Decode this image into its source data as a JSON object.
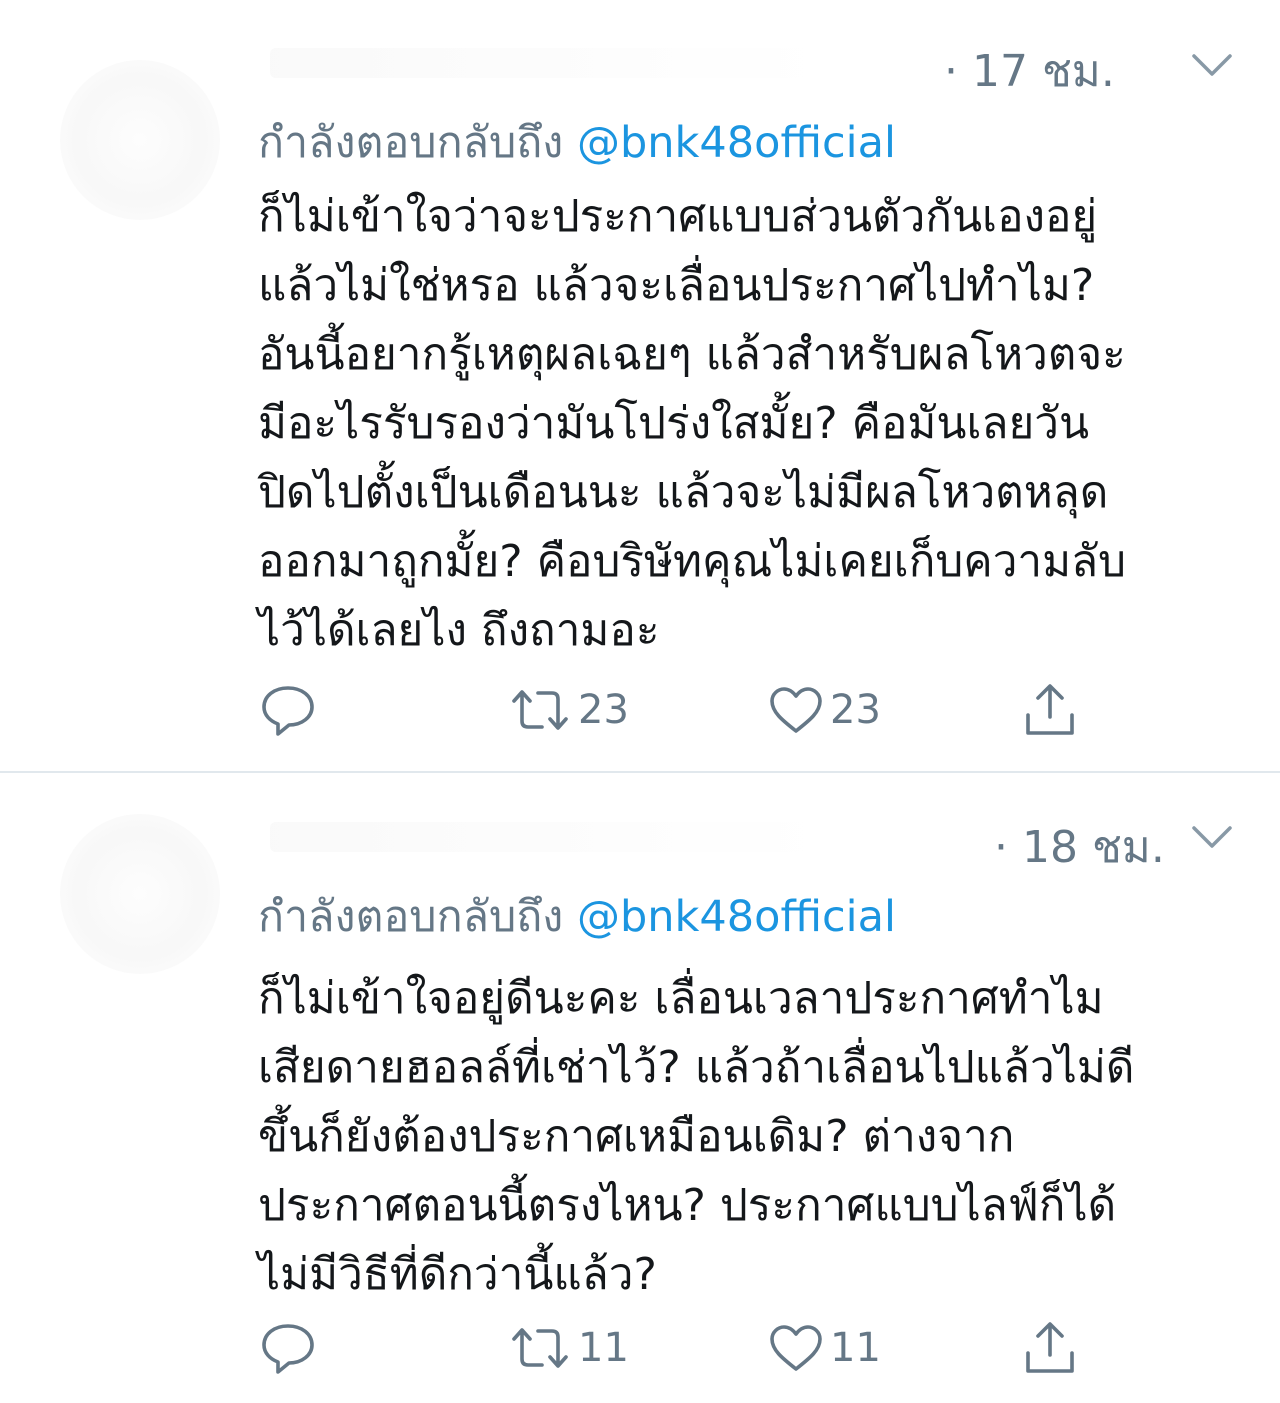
{
  "tweets": [
    {
      "time": "· 17 ชม.",
      "reply_prefix": "กำลังตอบกลับถึง",
      "reply_handle": "@bnk48official",
      "lines": [
        "ก็ไม่เข้าใจว่าจะประกาศแบบส่วนตัวกันเองอยู่",
        "แล้วไม่ใช่หรอ แล้วจะเลื่อนประกาศไปทำไม?",
        "อันนี้อยากรู้เหตุผลเฉยๆ แล้วสำหรับผลโหวตจะ",
        "มีอะไรรับรองว่ามันโปร่งใสมั้ย? คือมันเลยวัน",
        "ปิดไปตั้งเป็นเดือนนะ แล้วจะไม่มีผลโหวตหลุด",
        "ออกมาถูกมั้ย? คือบริษัทคุณไม่เคยเก็บความลับ",
        "ไว้ได้เลยไง ถึงถามอะ"
      ],
      "retweet_count": "23",
      "like_count": "23"
    },
    {
      "time": "· 18 ชม.",
      "reply_prefix": "กำลังตอบกลับถึง",
      "reply_handle": "@bnk48official",
      "lines": [
        "ก็ไม่เข้าใจอยู่ดีนะคะ เลื่อนเวลาประกาศทำไม",
        "เสียดายฮอลล์ที่เช่าไว้? แล้วถ้าเลื่อนไปแล้วไม่ดี",
        "ขึ้นก็ยังต้องประกาศเหมือนเดิม? ต่างจาก",
        "ประกาศตอนนี้ตรงไหน? ประกาศแบบไลฟ์ก็ได้",
        "ไม่มีวิธีที่ดีกว่านี้แล้ว?"
      ],
      "retweet_count": "11",
      "like_count": "11"
    }
  ],
  "icons": {
    "reply": "reply-icon",
    "retweet": "retweet-icon",
    "like": "heart-icon",
    "share": "share-icon",
    "more": "chevron-down-icon"
  },
  "colors": {
    "muted": "#657786",
    "link": "#1b95e0",
    "text": "#14171a",
    "divider": "#e1e8ed"
  }
}
